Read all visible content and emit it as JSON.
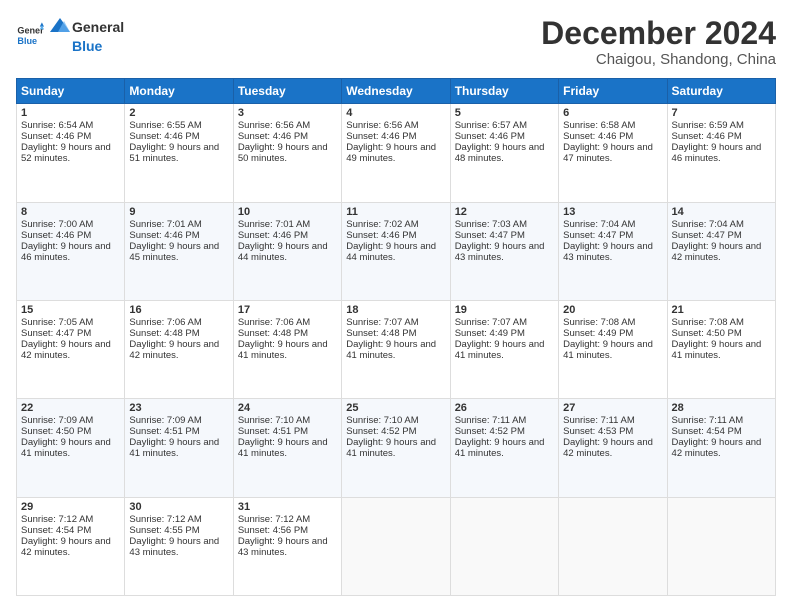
{
  "logo": {
    "general": "General",
    "blue": "Blue"
  },
  "header": {
    "month": "December 2024",
    "location": "Chaigou, Shandong, China"
  },
  "days_of_week": [
    "Sunday",
    "Monday",
    "Tuesday",
    "Wednesday",
    "Thursday",
    "Friday",
    "Saturday"
  ],
  "weeks": [
    [
      {
        "day": "1",
        "sunrise": "Sunrise: 6:54 AM",
        "sunset": "Sunset: 4:46 PM",
        "daylight": "Daylight: 9 hours and 52 minutes."
      },
      {
        "day": "2",
        "sunrise": "Sunrise: 6:55 AM",
        "sunset": "Sunset: 4:46 PM",
        "daylight": "Daylight: 9 hours and 51 minutes."
      },
      {
        "day": "3",
        "sunrise": "Sunrise: 6:56 AM",
        "sunset": "Sunset: 4:46 PM",
        "daylight": "Daylight: 9 hours and 50 minutes."
      },
      {
        "day": "4",
        "sunrise": "Sunrise: 6:56 AM",
        "sunset": "Sunset: 4:46 PM",
        "daylight": "Daylight: 9 hours and 49 minutes."
      },
      {
        "day": "5",
        "sunrise": "Sunrise: 6:57 AM",
        "sunset": "Sunset: 4:46 PM",
        "daylight": "Daylight: 9 hours and 48 minutes."
      },
      {
        "day": "6",
        "sunrise": "Sunrise: 6:58 AM",
        "sunset": "Sunset: 4:46 PM",
        "daylight": "Daylight: 9 hours and 47 minutes."
      },
      {
        "day": "7",
        "sunrise": "Sunrise: 6:59 AM",
        "sunset": "Sunset: 4:46 PM",
        "daylight": "Daylight: 9 hours and 46 minutes."
      }
    ],
    [
      {
        "day": "8",
        "sunrise": "Sunrise: 7:00 AM",
        "sunset": "Sunset: 4:46 PM",
        "daylight": "Daylight: 9 hours and 46 minutes."
      },
      {
        "day": "9",
        "sunrise": "Sunrise: 7:01 AM",
        "sunset": "Sunset: 4:46 PM",
        "daylight": "Daylight: 9 hours and 45 minutes."
      },
      {
        "day": "10",
        "sunrise": "Sunrise: 7:01 AM",
        "sunset": "Sunset: 4:46 PM",
        "daylight": "Daylight: 9 hours and 44 minutes."
      },
      {
        "day": "11",
        "sunrise": "Sunrise: 7:02 AM",
        "sunset": "Sunset: 4:46 PM",
        "daylight": "Daylight: 9 hours and 44 minutes."
      },
      {
        "day": "12",
        "sunrise": "Sunrise: 7:03 AM",
        "sunset": "Sunset: 4:47 PM",
        "daylight": "Daylight: 9 hours and 43 minutes."
      },
      {
        "day": "13",
        "sunrise": "Sunrise: 7:04 AM",
        "sunset": "Sunset: 4:47 PM",
        "daylight": "Daylight: 9 hours and 43 minutes."
      },
      {
        "day": "14",
        "sunrise": "Sunrise: 7:04 AM",
        "sunset": "Sunset: 4:47 PM",
        "daylight": "Daylight: 9 hours and 42 minutes."
      }
    ],
    [
      {
        "day": "15",
        "sunrise": "Sunrise: 7:05 AM",
        "sunset": "Sunset: 4:47 PM",
        "daylight": "Daylight: 9 hours and 42 minutes."
      },
      {
        "day": "16",
        "sunrise": "Sunrise: 7:06 AM",
        "sunset": "Sunset: 4:48 PM",
        "daylight": "Daylight: 9 hours and 42 minutes."
      },
      {
        "day": "17",
        "sunrise": "Sunrise: 7:06 AM",
        "sunset": "Sunset: 4:48 PM",
        "daylight": "Daylight: 9 hours and 41 minutes."
      },
      {
        "day": "18",
        "sunrise": "Sunrise: 7:07 AM",
        "sunset": "Sunset: 4:48 PM",
        "daylight": "Daylight: 9 hours and 41 minutes."
      },
      {
        "day": "19",
        "sunrise": "Sunrise: 7:07 AM",
        "sunset": "Sunset: 4:49 PM",
        "daylight": "Daylight: 9 hours and 41 minutes."
      },
      {
        "day": "20",
        "sunrise": "Sunrise: 7:08 AM",
        "sunset": "Sunset: 4:49 PM",
        "daylight": "Daylight: 9 hours and 41 minutes."
      },
      {
        "day": "21",
        "sunrise": "Sunrise: 7:08 AM",
        "sunset": "Sunset: 4:50 PM",
        "daylight": "Daylight: 9 hours and 41 minutes."
      }
    ],
    [
      {
        "day": "22",
        "sunrise": "Sunrise: 7:09 AM",
        "sunset": "Sunset: 4:50 PM",
        "daylight": "Daylight: 9 hours and 41 minutes."
      },
      {
        "day": "23",
        "sunrise": "Sunrise: 7:09 AM",
        "sunset": "Sunset: 4:51 PM",
        "daylight": "Daylight: 9 hours and 41 minutes."
      },
      {
        "day": "24",
        "sunrise": "Sunrise: 7:10 AM",
        "sunset": "Sunset: 4:51 PM",
        "daylight": "Daylight: 9 hours and 41 minutes."
      },
      {
        "day": "25",
        "sunrise": "Sunrise: 7:10 AM",
        "sunset": "Sunset: 4:52 PM",
        "daylight": "Daylight: 9 hours and 41 minutes."
      },
      {
        "day": "26",
        "sunrise": "Sunrise: 7:11 AM",
        "sunset": "Sunset: 4:52 PM",
        "daylight": "Daylight: 9 hours and 41 minutes."
      },
      {
        "day": "27",
        "sunrise": "Sunrise: 7:11 AM",
        "sunset": "Sunset: 4:53 PM",
        "daylight": "Daylight: 9 hours and 42 minutes."
      },
      {
        "day": "28",
        "sunrise": "Sunrise: 7:11 AM",
        "sunset": "Sunset: 4:54 PM",
        "daylight": "Daylight: 9 hours and 42 minutes."
      }
    ],
    [
      {
        "day": "29",
        "sunrise": "Sunrise: 7:12 AM",
        "sunset": "Sunset: 4:54 PM",
        "daylight": "Daylight: 9 hours and 42 minutes."
      },
      {
        "day": "30",
        "sunrise": "Sunrise: 7:12 AM",
        "sunset": "Sunset: 4:55 PM",
        "daylight": "Daylight: 9 hours and 43 minutes."
      },
      {
        "day": "31",
        "sunrise": "Sunrise: 7:12 AM",
        "sunset": "Sunset: 4:56 PM",
        "daylight": "Daylight: 9 hours and 43 minutes."
      },
      null,
      null,
      null,
      null
    ]
  ]
}
